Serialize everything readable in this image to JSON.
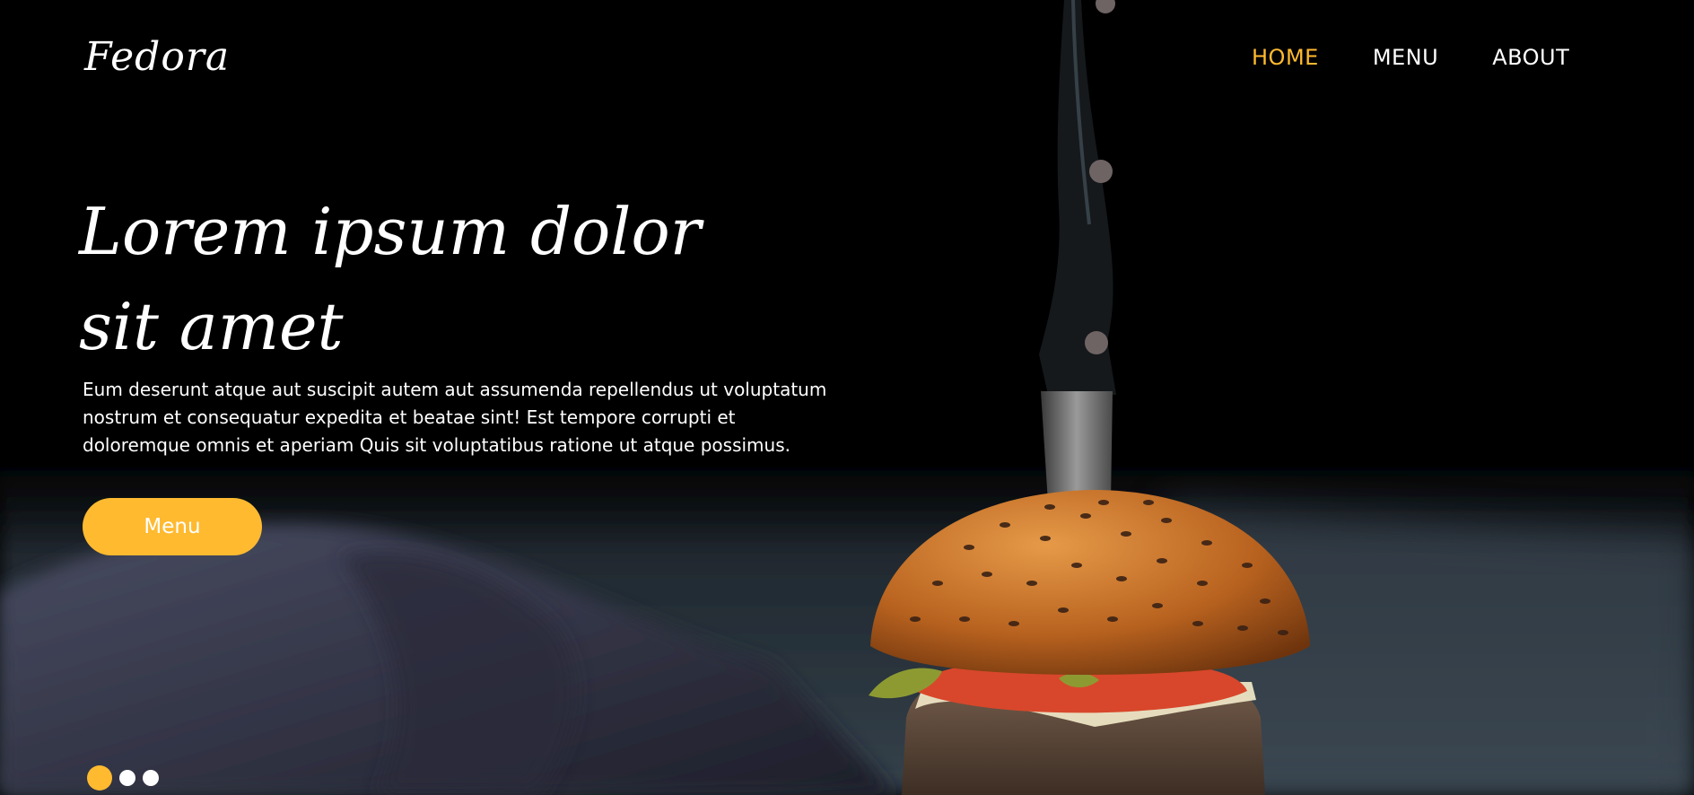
{
  "brand": {
    "name": "Fedora"
  },
  "nav": {
    "items": [
      {
        "label": "HOME",
        "active": true
      },
      {
        "label": "MENU",
        "active": false
      },
      {
        "label": "ABOUT",
        "active": false
      }
    ]
  },
  "hero": {
    "headline": "Lorem ipsum dolor sit amet",
    "lead": "Eum deserunt atque aut suscipit autem aut assumenda repellendus ut voluptatum nostrum et consequatur expedita et beatae sint! Est tempore corrupti et doloremque omnis et aperiam Quis sit voluptatibus ratione ut atque possimus.",
    "cta_label": "Menu",
    "image_subject": "burger-with-knife-photo"
  },
  "carousel": {
    "slide_count": 3,
    "active_index": 0
  },
  "colors": {
    "accent": "#ffba30",
    "background": "#000000",
    "text": "#ffffff"
  }
}
